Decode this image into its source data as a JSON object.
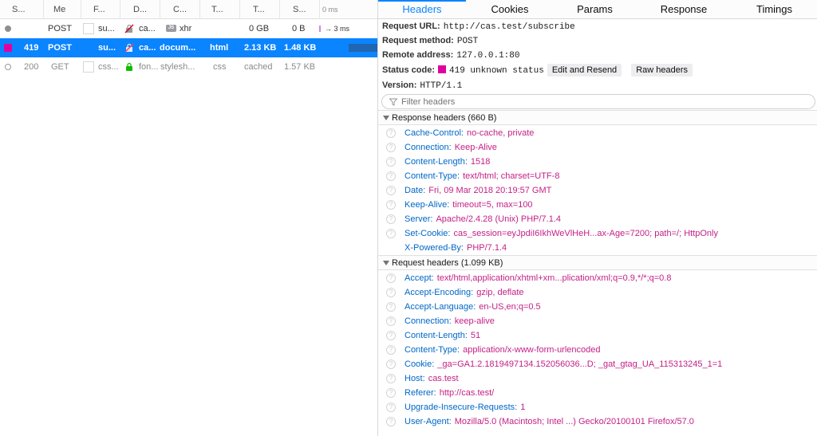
{
  "request_list": {
    "columns": {
      "status": "S...",
      "method": "Me",
      "file": "F...",
      "domain": "D...",
      "cause": "C...",
      "type": "T...",
      "transferred": "T...",
      "size": "S...",
      "waterfall": "0 ms"
    },
    "rows": [
      {
        "status": "",
        "method": "POST",
        "file": "su...",
        "domain": "ca...",
        "cause": "xhr",
        "type": "",
        "transferred": "0 GB",
        "size": "0 B",
        "timing": "→ 3 ms"
      },
      {
        "status": "419",
        "method": "POST",
        "file": "su...",
        "domain": "ca...",
        "cause": "docum...",
        "type": "html",
        "transferred": "2.13 KB",
        "size": "1.48 KB",
        "timing": ""
      },
      {
        "status": "200",
        "method": "GET",
        "file": "css...",
        "domain": "fon...",
        "cause": "stylesh...",
        "type": "css",
        "transferred": "cached",
        "size": "1.57 KB",
        "timing": ""
      }
    ],
    "js_badge": "JS"
  },
  "tabs": [
    "Headers",
    "Cookies",
    "Params",
    "Response",
    "Timings"
  ],
  "summary": {
    "url_label": "Request URL:",
    "url": "http://cas.test/subscribe",
    "method_label": "Request method:",
    "method": "POST",
    "remote_label": "Remote address:",
    "remote": "127.0.0.1:80",
    "status_label": "Status code:",
    "status": "419 unknown status",
    "edit_resend": "Edit and Resend",
    "raw_headers": "Raw headers",
    "version_label": "Version:",
    "version": "HTTP/1.1"
  },
  "filter": {
    "placeholder": "Filter headers"
  },
  "response_headers": {
    "title": "Response headers (660 B)",
    "items": [
      {
        "name": "Cache-Control:",
        "value": "no-cache, private"
      },
      {
        "name": "Connection:",
        "value": "Keep-Alive"
      },
      {
        "name": "Content-Length:",
        "value": "1518"
      },
      {
        "name": "Content-Type:",
        "value": "text/html; charset=UTF-8"
      },
      {
        "name": "Date:",
        "value": "Fri, 09 Mar 2018 20:19:57 GMT"
      },
      {
        "name": "Keep-Alive:",
        "value": "timeout=5, max=100"
      },
      {
        "name": "Server:",
        "value": "Apache/2.4.28 (Unix) PHP/7.1.4"
      },
      {
        "name": "Set-Cookie:",
        "value": "cas_session=eyJpdiI6IkhWeVlHeH...ax-Age=7200; path=/; HttpOnly"
      },
      {
        "name": "X-Powered-By:",
        "value": "PHP/7.1.4"
      }
    ]
  },
  "request_headers": {
    "title": "Request headers (1.099 KB)",
    "items": [
      {
        "name": "Accept:",
        "value": "text/html,application/xhtml+xm...plication/xml;q=0.9,*/*;q=0.8"
      },
      {
        "name": "Accept-Encoding:",
        "value": "gzip, deflate"
      },
      {
        "name": "Accept-Language:",
        "value": "en-US,en;q=0.5"
      },
      {
        "name": "Connection:",
        "value": "keep-alive"
      },
      {
        "name": "Content-Length:",
        "value": "51"
      },
      {
        "name": "Content-Type:",
        "value": "application/x-www-form-urlencoded"
      },
      {
        "name": "Cookie:",
        "value": "_ga=GA1.2.1819497134.152056036...D; _gat_gtag_UA_115313245_1=1"
      },
      {
        "name": "Host:",
        "value": "cas.test"
      },
      {
        "name": "Referer:",
        "value": "http://cas.test/"
      },
      {
        "name": "Upgrade-Insecure-Requests:",
        "value": "1"
      },
      {
        "name": "User-Agent:",
        "value": "Mozilla/5.0 (Macintosh; Intel ...) Gecko/20100101 Firefox/57.0"
      }
    ]
  },
  "colors": {
    "accent": "#0a84ff",
    "status_419": "#e0009f",
    "header_name": "#0067c7",
    "header_value": "#c41f86"
  }
}
